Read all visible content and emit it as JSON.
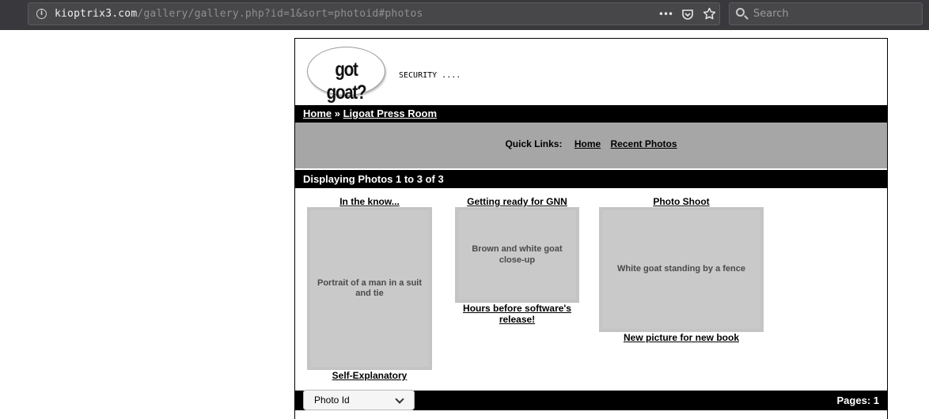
{
  "browser": {
    "url_host": "kioptrix3.com",
    "url_path": "/gallery/gallery.php?id=1&sort=photoid#photos",
    "search_placeholder": "Search",
    "menu_icon": "•••"
  },
  "header": {
    "logo_text": "got goat?",
    "tagline": "SECURITY ...."
  },
  "breadcrumb": {
    "home": "Home",
    "separator": " » ",
    "current": "Ligoat Press Room"
  },
  "quick_links": {
    "label": "Quick Links:",
    "home": "Home",
    "recent": "Recent Photos"
  },
  "status": "Displaying Photos 1 to 3 of 3",
  "photos": [
    {
      "title": "In the know...",
      "caption": "Self-Explanatory",
      "image": "Portrait of a man in a suit and tie"
    },
    {
      "title": "Getting ready for GNN",
      "caption": "Hours before software's release!",
      "image": "Brown and white goat close-up"
    },
    {
      "title": "Photo Shoot",
      "caption": "New picture for new book",
      "image": "White goat standing by a fence"
    }
  ],
  "footer": {
    "sort_value": "Photo Id",
    "pages": "Pages: 1"
  }
}
